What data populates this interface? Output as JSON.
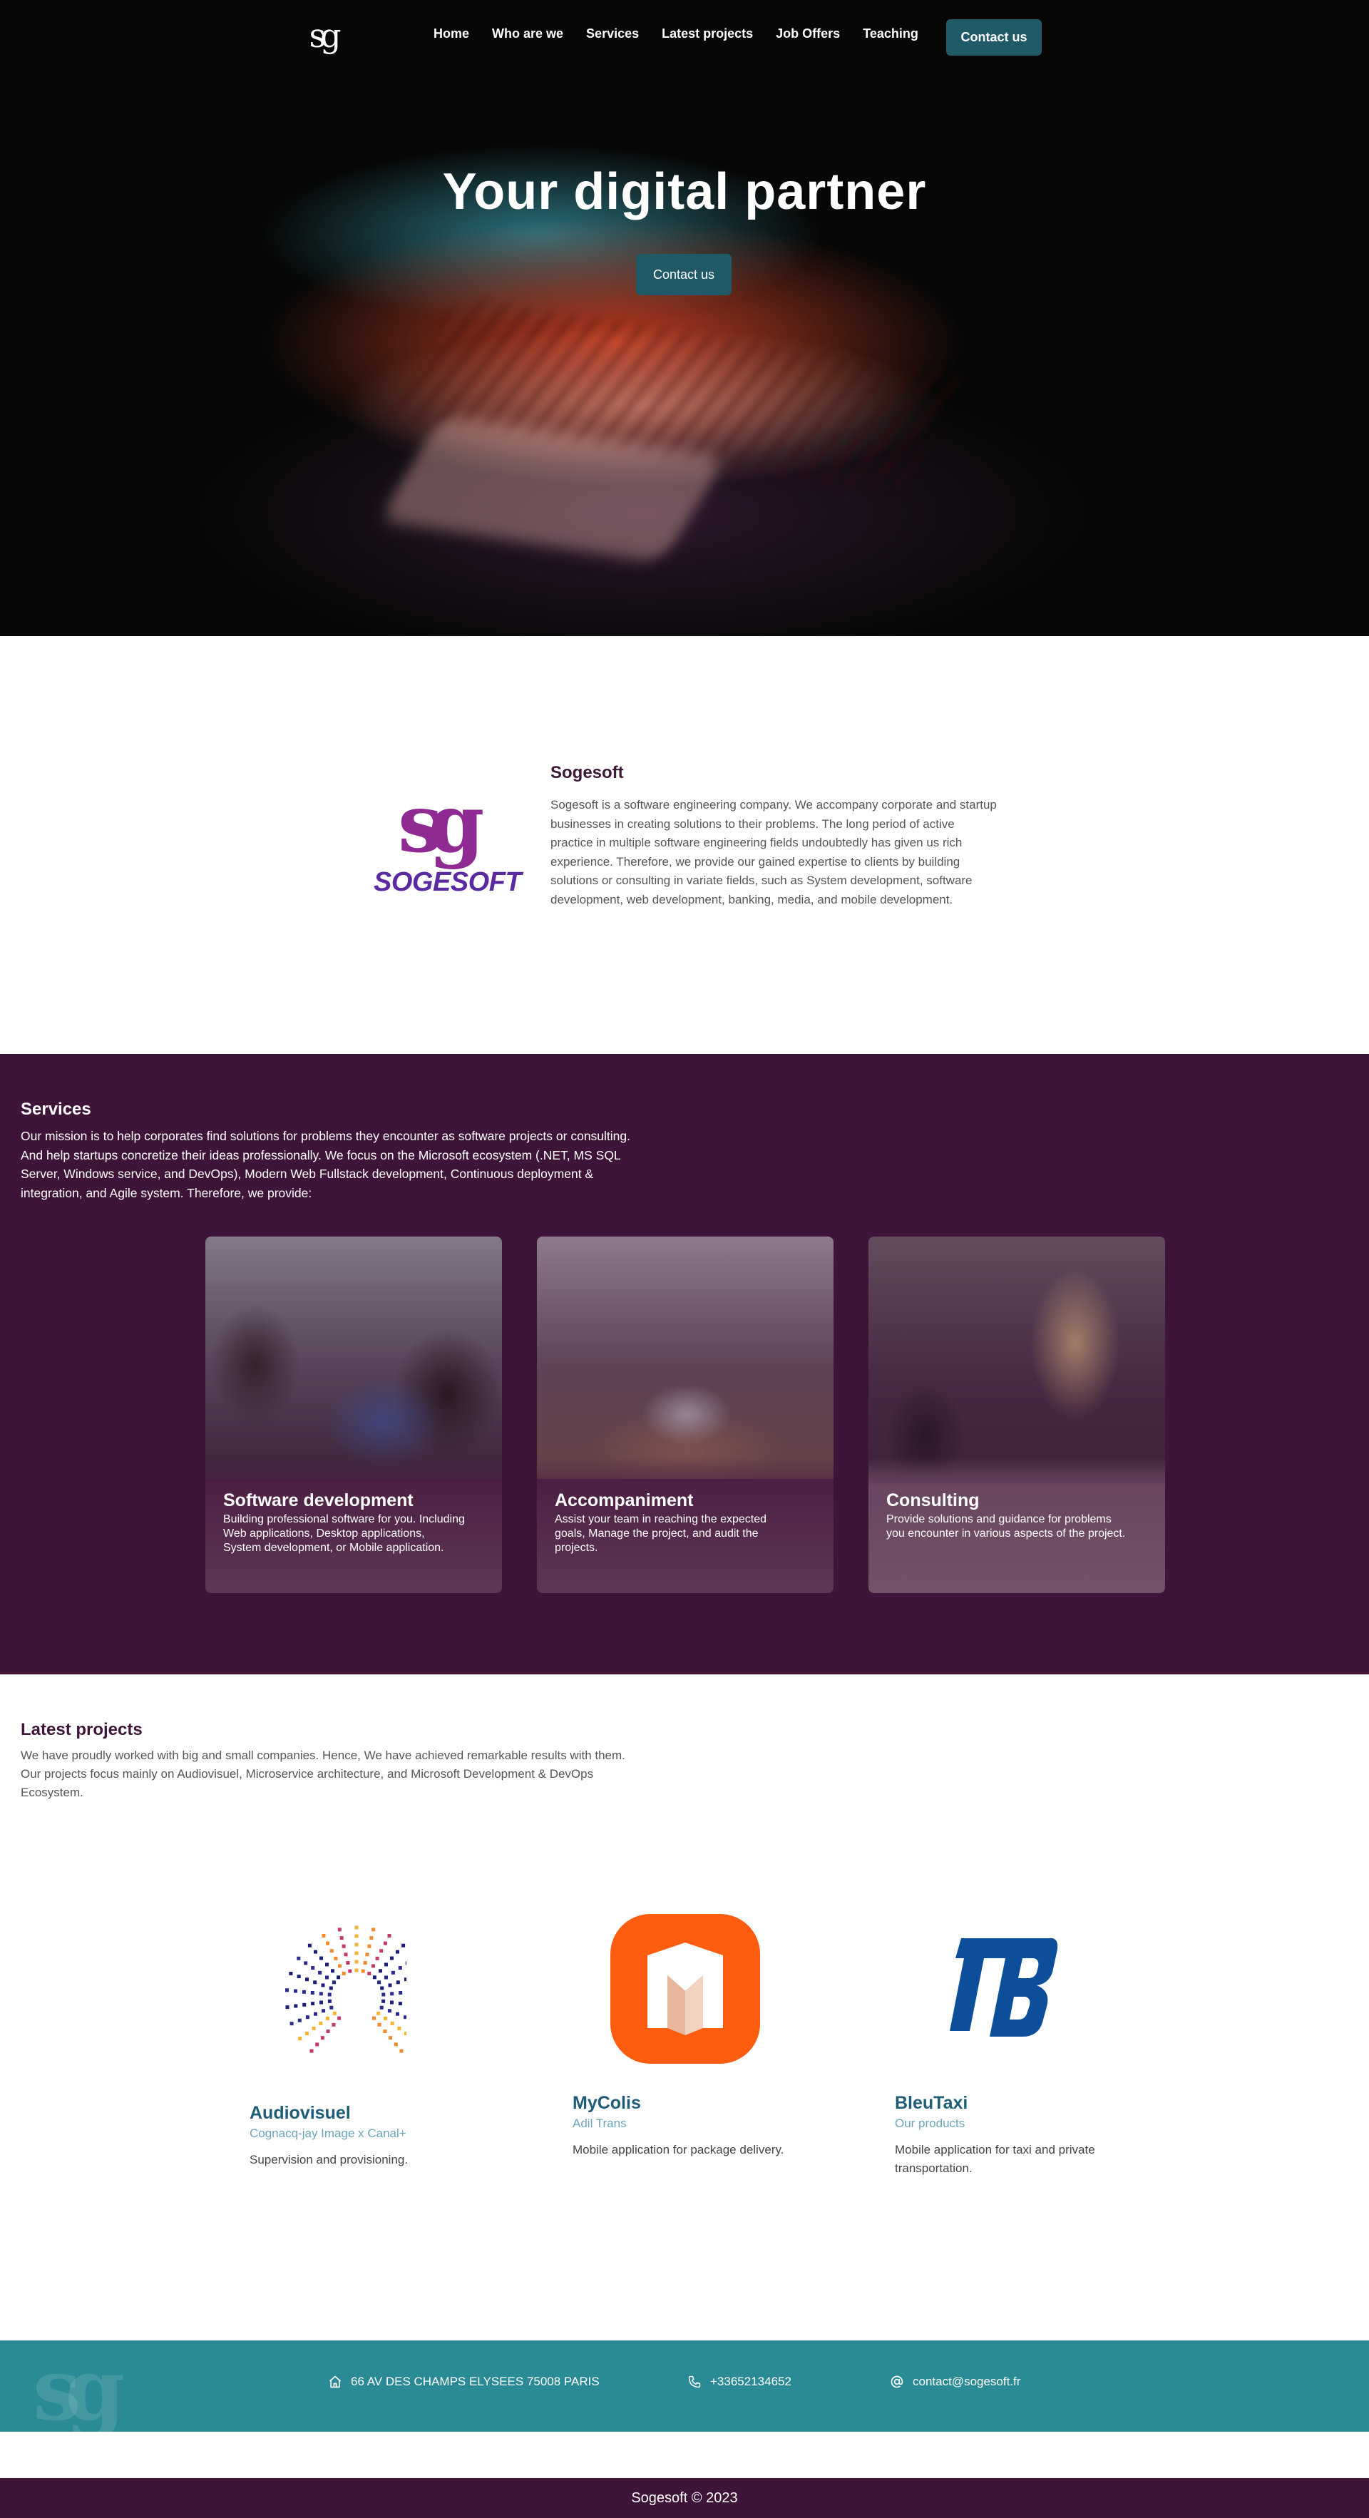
{
  "nav": {
    "logo": "sg",
    "links": [
      "Home",
      "Who are we",
      "Services",
      "Latest projects",
      "Job Offers",
      "Teaching"
    ],
    "cta": "Contact us"
  },
  "hero": {
    "title": "Your digital partner",
    "cta": "Contact us"
  },
  "about": {
    "logo_mark": "sg",
    "logo_word": "SOGESOFT",
    "title": "Sogesoft",
    "text": "Sogesoft is a software engineering company. We accompany corporate and startup businesses in creating solutions to their problems. The long period of active practice in multiple software engineering fields undoubtedly has given us rich experience. Therefore, we provide our gained expertise to clients by building solutions or consulting in variate fields, such as System development, software development, web development, banking, media, and mobile development."
  },
  "services": {
    "title": "Services",
    "text": "Our mission is to help corporates find solutions for problems they encounter as software projects or consulting. And help startups concretize their ideas professionally. We focus on the Microsoft ecosystem (.NET, MS SQL Server, Windows service, and DevOps), Modern Web Fullstack development, Continuous deployment & integration, and Agile system. Therefore, we provide:",
    "cards": [
      {
        "title": "Software development",
        "text": "Building professional software for you. Including Web applications, Desktop applications, System development, or Mobile application."
      },
      {
        "title": "Accompaniment",
        "text": "Assist your team in reaching the expected goals, Manage the project, and audit the projects."
      },
      {
        "title": "Consulting",
        "text": "Provide solutions and guidance for problems you encounter in various aspects of the project."
      }
    ]
  },
  "projects": {
    "title": "Latest projects",
    "text": "We have proudly worked with big and small companies. Hence, We have achieved remarkable results with them. Our projects focus mainly on Audiovisuel, Microservice architecture, and Microsoft Development & DevOps Ecosystem.",
    "items": [
      {
        "name": "Audiovisuel",
        "sub": "Cognacq-jay Image x Canal+",
        "desc": "Supervision and provisioning."
      },
      {
        "name": "MyColis",
        "sub": "Adil Trans",
        "desc": "Mobile application for package delivery."
      },
      {
        "name": "BleuTaxi",
        "sub": "Our products",
        "desc": "Mobile application for taxi and private transportation."
      }
    ]
  },
  "contact": {
    "address": "66 AV DES CHAMPS ELYSEES 75008 PARIS",
    "phone": "+33652134652",
    "email": "contact@sogesoft.fr",
    "icons": [
      "home-icon",
      "phone-icon",
      "at-icon"
    ]
  },
  "footer": {
    "text": "Sogesoft © 2023"
  },
  "colors": {
    "primary": "#3e1539",
    "accent": "#205a66",
    "teal": "#2a8a95",
    "link": "#1e5d77"
  }
}
